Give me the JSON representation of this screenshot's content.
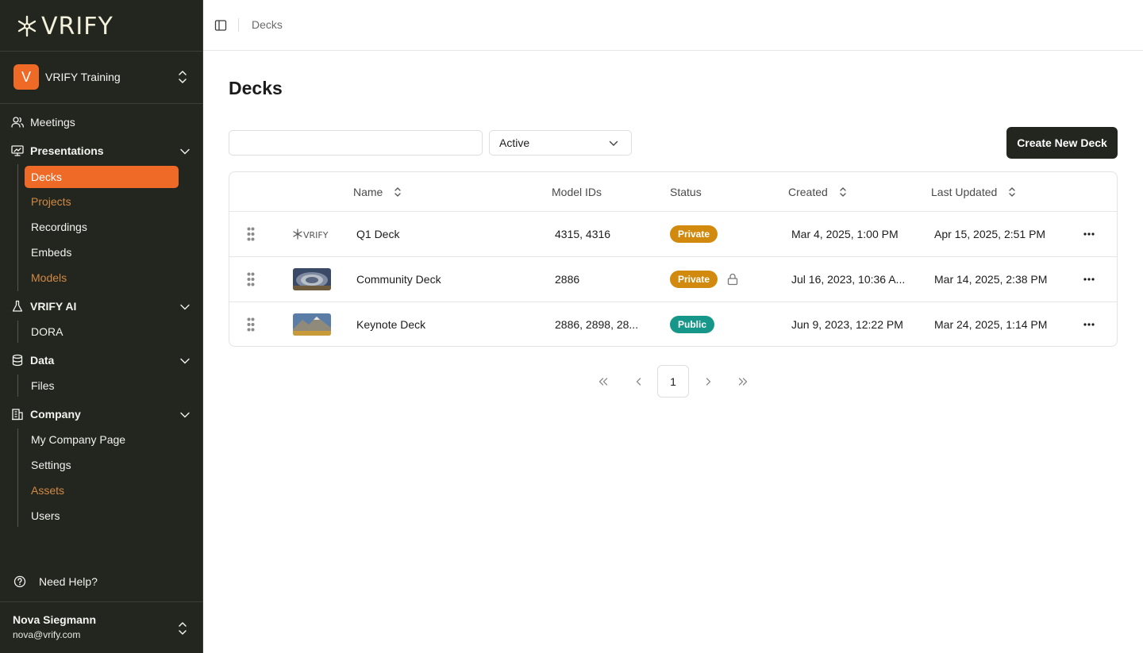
{
  "app": {
    "logo_text": "VRIFY"
  },
  "org": {
    "initial": "V",
    "name": "VRIFY Training"
  },
  "nav": {
    "meetings": "Meetings",
    "presentations": "Presentations",
    "presentations_items": [
      "Decks",
      "Projects",
      "Recordings",
      "Embeds",
      "Models"
    ],
    "vrify_ai": "VRIFY AI",
    "vrify_ai_items": [
      "DORA"
    ],
    "data": "Data",
    "data_items": [
      "Files"
    ],
    "company": "Company",
    "company_items": [
      "My Company Page",
      "Settings",
      "Assets",
      "Users"
    ],
    "help": "Need Help?"
  },
  "user": {
    "name": "Nova Siegmann",
    "email": "nova@vrify.com"
  },
  "topbar": {
    "breadcrumb": "Decks"
  },
  "page": {
    "title": "Decks",
    "search_value": "",
    "status_filter": "Active",
    "create_button": "Create New Deck"
  },
  "table": {
    "headers": {
      "name": "Name",
      "model_ids": "Model IDs",
      "status": "Status",
      "created": "Created",
      "last_updated": "Last Updated"
    },
    "rows": [
      {
        "name": "Q1 Deck",
        "model_ids": "4315, 4316",
        "status": "Private",
        "locked": false,
        "created": "Mar 4, 2025, 1:00 PM",
        "last_updated": "Apr 15, 2025, 2:51 PM",
        "thumb": "vrify-logo"
      },
      {
        "name": "Community Deck",
        "model_ids": "2886",
        "status": "Private",
        "locked": true,
        "created": "Jul 16, 2023, 10:36 A...",
        "last_updated": "Mar 14, 2025, 2:38 PM",
        "thumb": "pit-image"
      },
      {
        "name": "Keynote Deck",
        "model_ids": "2886, 2898, 28...",
        "status": "Public",
        "locked": false,
        "created": "Jun 9, 2023, 12:22 PM",
        "last_updated": "Mar 24, 2025, 1:14 PM",
        "thumb": "mountain-image"
      }
    ]
  },
  "pagination": {
    "current_page": "1"
  },
  "colors": {
    "accent": "#ef6a26",
    "sidebar_bg": "#23251f",
    "private_badge": "#d18a0d",
    "public_badge": "#17968a",
    "muted_link": "#d18a44"
  }
}
